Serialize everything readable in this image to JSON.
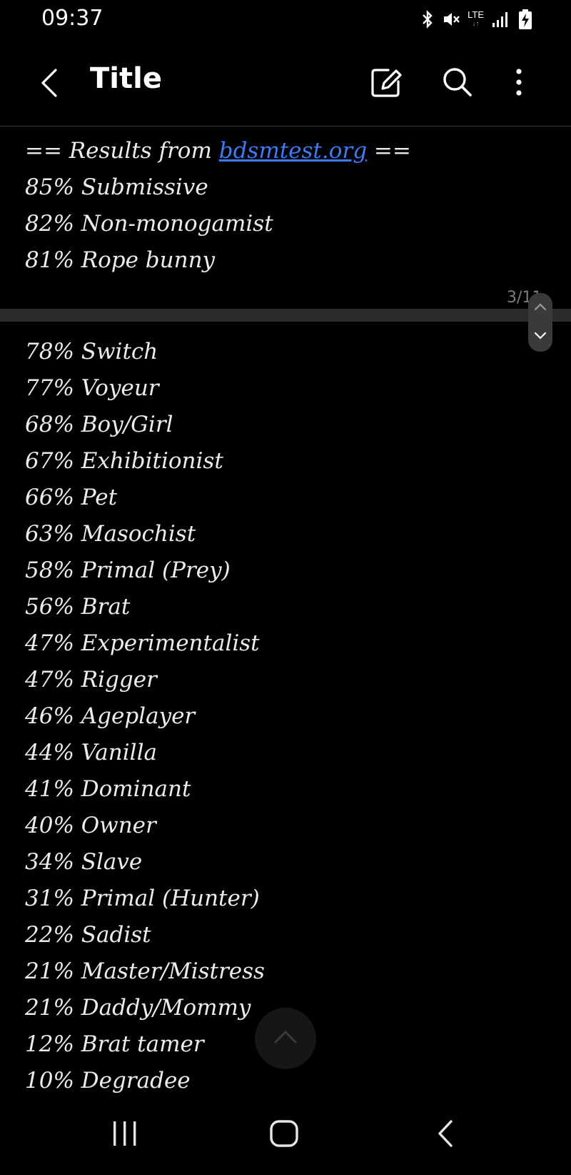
{
  "status_bar": {
    "time": "09:37",
    "network": "LTE",
    "icons": [
      "bluetooth-icon",
      "mute-icon",
      "lte-icon",
      "signal-icon",
      "battery-charging-icon"
    ]
  },
  "app_bar": {
    "title": "Title",
    "icons": [
      "back-arrow-icon",
      "edit-icon",
      "search-icon",
      "more-vert-icon"
    ]
  },
  "note": {
    "header_prefix": "== Results from ",
    "header_link": "bdsmtest.org",
    "header_suffix": " ==",
    "page_indicator": "3/11",
    "results_page_1": [
      "85% Submissive",
      "82% Non-monogamist",
      "81% Rope bunny"
    ],
    "results_page_2": [
      "78% Switch",
      "77% Voyeur",
      "68% Boy/Girl",
      "67% Exhibitionist",
      "66% Pet",
      "63% Masochist",
      "58% Primal (Prey)",
      "56% Brat",
      "47% Experimentalist",
      "47% Rigger",
      "46% Ageplayer",
      "44% Vanilla",
      "41% Dominant",
      "40% Owner",
      "34% Slave",
      "31% Primal (Hunter)",
      "22% Sadist",
      "21% Master/Mistress",
      "21% Daddy/Mommy",
      "12% Brat tamer",
      "10% Degradee"
    ]
  },
  "nav_bar": {
    "icons": [
      "recents-icon",
      "home-icon",
      "back-icon"
    ]
  },
  "colors": {
    "background": "#000000",
    "text": "#ececec",
    "link": "#3a7cf5",
    "page_break": "#2b2b2b"
  }
}
